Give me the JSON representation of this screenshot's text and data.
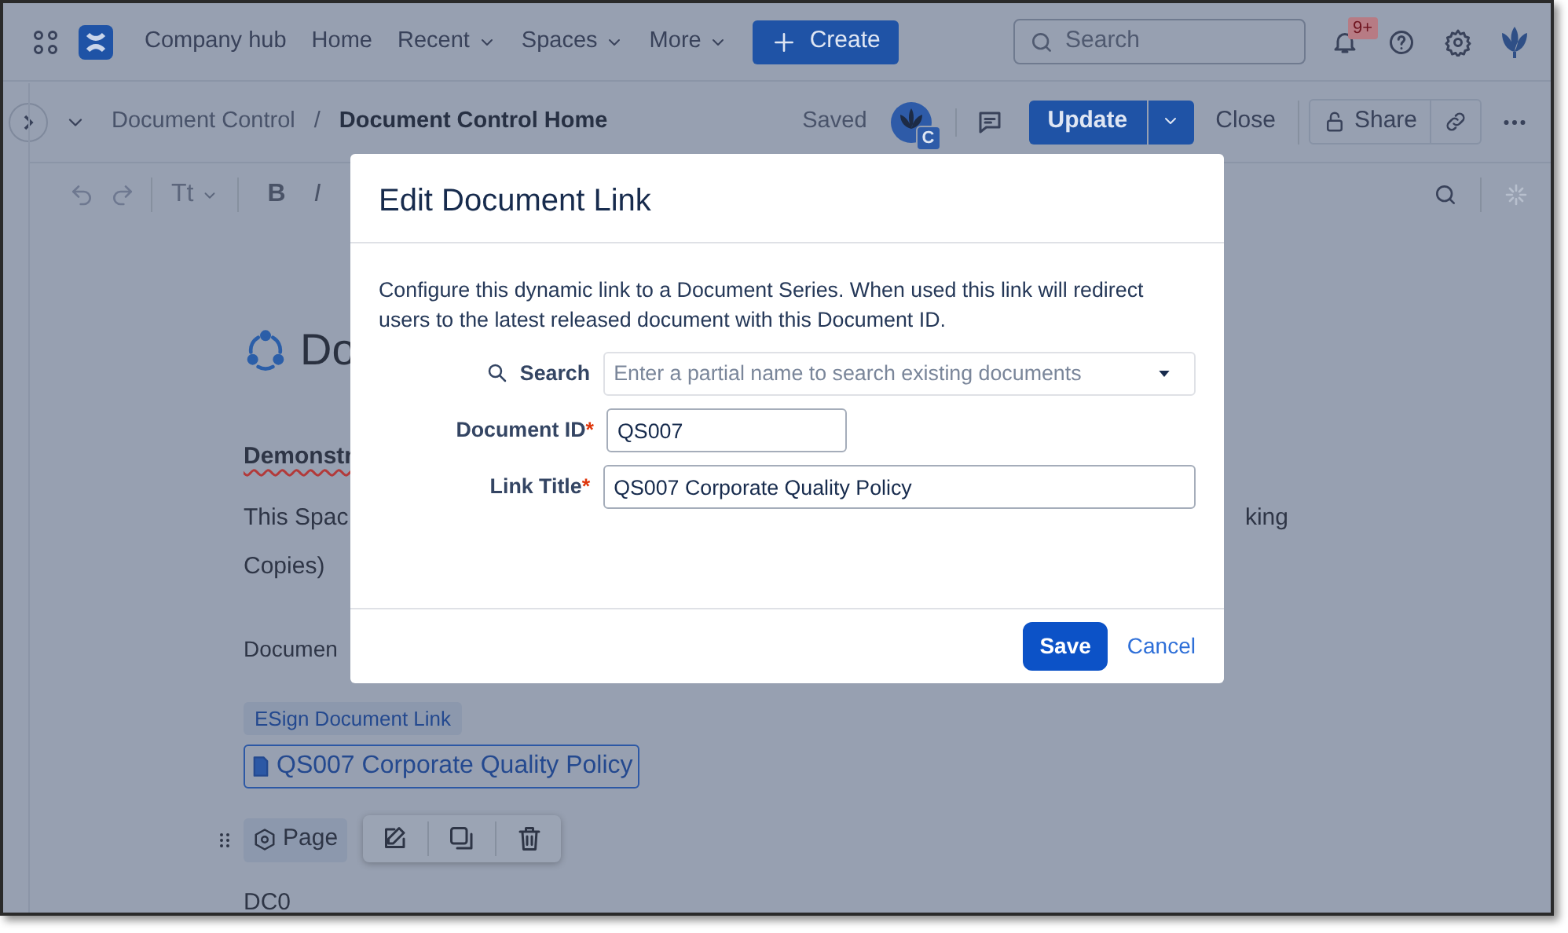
{
  "topnav": {
    "items": [
      {
        "label": "Company hub",
        "dropdown": false
      },
      {
        "label": "Home",
        "dropdown": false
      },
      {
        "label": "Recent",
        "dropdown": true
      },
      {
        "label": "Spaces",
        "dropdown": true
      },
      {
        "label": "More",
        "dropdown": true
      }
    ],
    "create_button": "Create",
    "search": {
      "placeholder": "Search"
    },
    "notification_badge": "9+"
  },
  "page_header": {
    "breadcrumbs": [
      {
        "label": "Document Control",
        "current": false
      },
      {
        "label": "Document Control Home",
        "current": true
      }
    ],
    "breadcrumb_separator": "/",
    "status": "Saved",
    "avatar_badge": "C",
    "update_button": "Update",
    "close_button": "Close",
    "share_button": "Share"
  },
  "editor_toolbar": {
    "text_style_button": "Tt",
    "bold_button": "B",
    "italic_button": "I"
  },
  "content": {
    "title_fragment": "Do",
    "heading_fragment": "Demonstr",
    "paragraph_fragment": "This Spac",
    "paragraph_tail": "king",
    "paragraph_line2": "Copies)",
    "label_fragment": "Documen",
    "macro_label": "ESign Document Link",
    "doc_link": "QS007 Corporate Quality Policy",
    "page_chip": "Page",
    "footer_text": "DC0"
  },
  "dialog": {
    "title": "Edit Document Link",
    "description": "Configure this dynamic link to a Document Series. When used this link will redirect users to the latest released document with this Document ID.",
    "fields": [
      {
        "kind": "search",
        "label": "Search",
        "placeholder": "Enter a partial name to search existing documents"
      },
      {
        "kind": "text",
        "label": "Document ID",
        "required_mark": "*",
        "value": "QS007"
      },
      {
        "kind": "text",
        "label": "Link Title",
        "required_mark": "*",
        "value": "QS007 Corporate Quality Policy"
      }
    ],
    "save_button": "Save",
    "cancel_link": "Cancel"
  }
}
